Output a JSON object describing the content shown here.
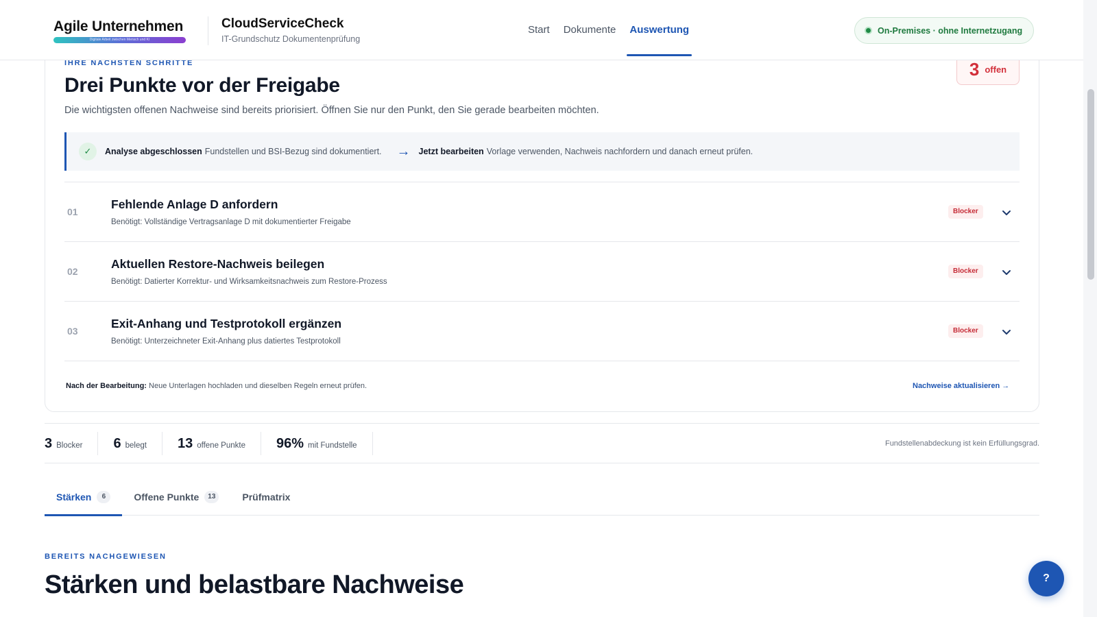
{
  "header": {
    "brand_name": "Agile Unternehmen",
    "brand_tagline": "Digitale Arbeit zwischen Mensch und KI",
    "product_name": "CloudServiceCheck",
    "product_subtitle": "IT-Grundschutz Dokumentenprüfung",
    "nav": [
      {
        "label": "Start",
        "active": false
      },
      {
        "label": "Dokumente",
        "active": false
      },
      {
        "label": "Auswertung",
        "active": true
      }
    ],
    "environment_badge": "On-Premises · ohne Internetzugang"
  },
  "next_steps": {
    "eyebrow": "IHRE NÄCHSTEN SCHRITTE",
    "open_count": "3",
    "open_label": "offen",
    "title": "Drei Punkte vor der Freigabe",
    "description": "Die wichtigsten offenen Nachweise sind bereits priorisiert. Öffnen Sie nur den Punkt, den Sie gerade bearbeiten möchten.",
    "info_bar": {
      "done_label": "Analyse abgeschlossen",
      "done_text": "Fundstellen und BSI-Bezug sind dokumentiert.",
      "next_label": "Jetzt bearbeiten",
      "next_text": "Vorlage verwenden, Nachweis nachfordern und danach erneut prüfen."
    },
    "tasks": [
      {
        "num": "01",
        "title": "Fehlende Anlage D anfordern",
        "subtitle": "Benötigt: Vollständige Vertragsanlage D mit dokumentierter Freigabe",
        "badge": "Blocker"
      },
      {
        "num": "02",
        "title": "Aktuellen Restore-Nachweis beilegen",
        "subtitle": "Benötigt: Datierter Korrektur- und Wirksamkeitsnachweis zum Restore-Prozess",
        "badge": "Blocker"
      },
      {
        "num": "03",
        "title": "Exit-Anhang und Testprotokoll ergänzen",
        "subtitle": "Benötigt: Unterzeichneter Exit-Anhang plus datiertes Testprotokoll",
        "badge": "Blocker"
      }
    ],
    "after_label": "Nach der Bearbeitung:",
    "after_text": "Neue Unterlagen hochladen und dieselben Regeln erneut prüfen.",
    "refresh_link": "Nachweise aktualisieren →"
  },
  "stats": {
    "items": [
      {
        "value": "3",
        "label": "Blocker"
      },
      {
        "value": "6",
        "label": "belegt"
      },
      {
        "value": "13",
        "label": "offene Punkte"
      },
      {
        "value": "96%",
        "label": "mit Fundstelle"
      }
    ],
    "note": "Fundstellenabdeckung ist kein Erfüllungsgrad."
  },
  "tabs": [
    {
      "label": "Stärken",
      "count": "6",
      "active": true
    },
    {
      "label": "Offene Punkte",
      "count": "13",
      "active": false
    },
    {
      "label": "Prüfmatrix",
      "count": "",
      "active": false
    }
  ],
  "strengths": {
    "eyebrow": "BEREITS NACHGEWIESEN",
    "title": "Stärken und belastbare Nachweise"
  },
  "help_button": "?",
  "colors": {
    "accent": "#1e56b3",
    "blocker": "#c52b36",
    "success": "#1f8a45"
  }
}
